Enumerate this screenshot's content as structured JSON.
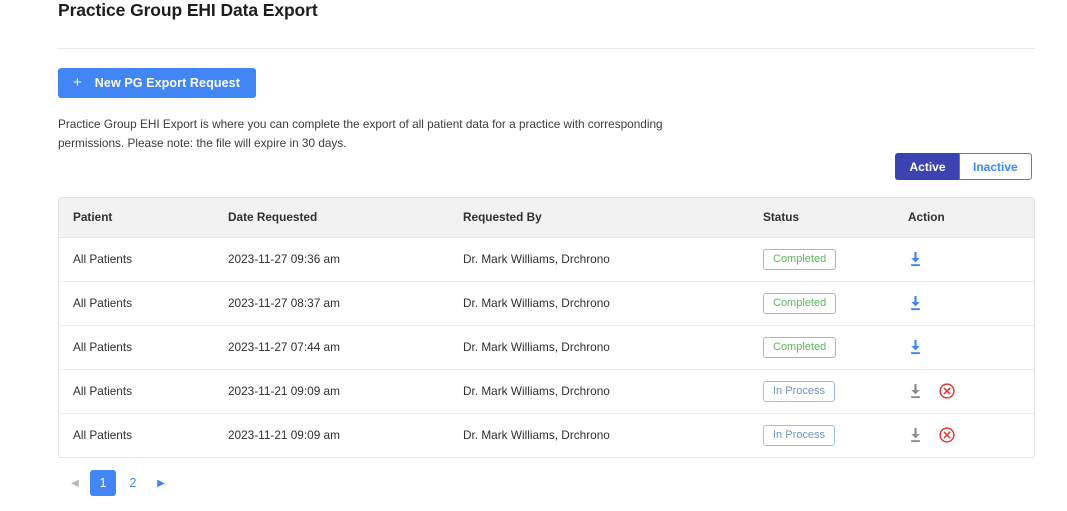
{
  "page": {
    "title": "Practice Group EHI Data Export",
    "description": "Practice Group EHI Export is where you can complete the export of all patient data for a practice with corresponding permissions. Please note: the file will expire in 30 days."
  },
  "actions": {
    "new_request_label": "New PG Export Request",
    "new_request_icon": "plus-icon",
    "plus_glyph": "+"
  },
  "filter_toggle": {
    "options": [
      {
        "label": "Active",
        "selected": true
      },
      {
        "label": "Inactive",
        "selected": false
      }
    ]
  },
  "table": {
    "columns": [
      "Patient",
      "Date Requested",
      "Requested By",
      "Status",
      "Action"
    ],
    "rows": [
      {
        "patient": "All Patients",
        "date_requested": "2023-11-27 09:36 am",
        "requested_by": "Dr. Mark Williams, Drchrono",
        "status": "Completed",
        "status_kind": "completed",
        "download_enabled": true,
        "cancel_available": false
      },
      {
        "patient": "All Patients",
        "date_requested": "2023-11-27 08:37 am",
        "requested_by": "Dr. Mark Williams, Drchrono",
        "status": "Completed",
        "status_kind": "completed",
        "download_enabled": true,
        "cancel_available": false
      },
      {
        "patient": "All Patients",
        "date_requested": "2023-11-27 07:44 am",
        "requested_by": "Dr. Mark Williams, Drchrono",
        "status": "Completed",
        "status_kind": "completed",
        "download_enabled": true,
        "cancel_available": false
      },
      {
        "patient": "All Patients",
        "date_requested": "2023-11-21 09:09 am",
        "requested_by": "Dr. Mark Williams, Drchrono",
        "status": "In Process",
        "status_kind": "in-process",
        "download_enabled": false,
        "cancel_available": true
      },
      {
        "patient": "All Patients",
        "date_requested": "2023-11-21 09:09 am",
        "requested_by": "Dr. Mark Williams, Drchrono",
        "status": "In Process",
        "status_kind": "in-process",
        "download_enabled": false,
        "cancel_available": true
      }
    ],
    "icons": {
      "download": "download-icon",
      "cancel": "cancel-circle-icon"
    }
  },
  "pagination": {
    "prev_glyph": "◀",
    "next_glyph": "▶",
    "pages": [
      "1",
      "2"
    ],
    "current_page": "1"
  },
  "colors": {
    "primary_blue": "#4285f4",
    "active_indigo": "#3b43b0",
    "completed_green": "#5bb85b",
    "in_process_blue": "#6e94c4",
    "cancel_red": "#e03b3b",
    "disabled_gray": "#8a8c8f"
  }
}
